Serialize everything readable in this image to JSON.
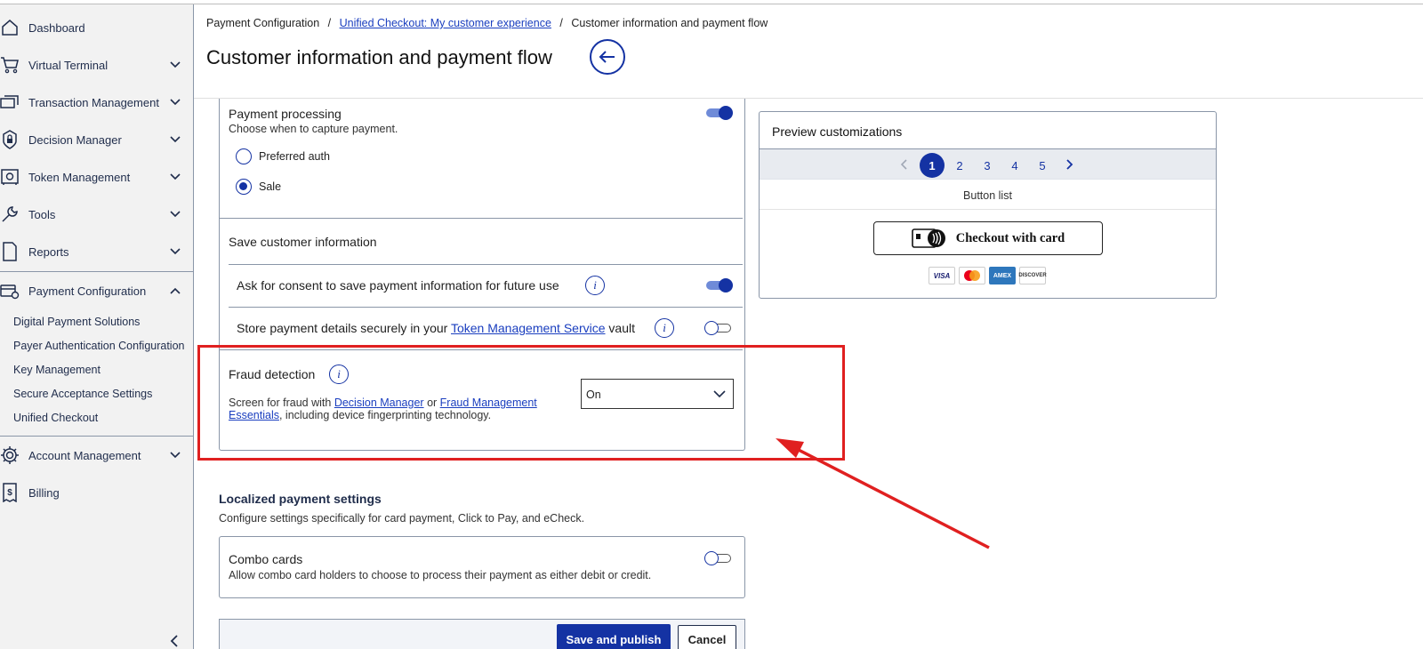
{
  "sidebar": {
    "items": [
      {
        "label": "Dashboard",
        "icon": "home-icon"
      },
      {
        "label": "Virtual Terminal",
        "icon": "cart-icon"
      },
      {
        "label": "Transaction Management",
        "icon": "transactions-icon"
      },
      {
        "label": "Decision Manager",
        "icon": "lock-shield-icon"
      },
      {
        "label": "Token Management",
        "icon": "safe-icon"
      },
      {
        "label": "Tools",
        "icon": "wrench-icon"
      },
      {
        "label": "Reports",
        "icon": "document-icon"
      },
      {
        "label": "Payment Configuration",
        "icon": "card-gear-icon"
      },
      {
        "label": "Account Management",
        "icon": "gear-icon"
      },
      {
        "label": "Billing",
        "icon": "receipt-icon"
      }
    ],
    "sub_items": [
      "Digital Payment Solutions",
      "Payer Authentication Configuration",
      "Key Management",
      "Secure Acceptance Settings",
      "Unified Checkout"
    ]
  },
  "header": {
    "breadcrumb": {
      "item1": "Payment Configuration",
      "separator": "/",
      "item2": "Unified Checkout: My customer experience",
      "item3": "Customer information and payment flow"
    },
    "title": "Customer information and payment flow"
  },
  "payment_processing": {
    "title": "Payment processing",
    "subtitle": "Choose when to capture payment.",
    "toggle_on": true,
    "options": [
      "Preferred auth",
      "Sale"
    ],
    "selected": "Sale"
  },
  "save_info": {
    "title": "Save customer information",
    "consent_label": "Ask for consent to save payment information for future use",
    "consent_on": true,
    "store_prefix": "Store payment details securely in your",
    "store_link": "Token Management Service",
    "store_suffix": "vault",
    "store_on": false
  },
  "fraud": {
    "title": "Fraud detection",
    "desc_prefix": "Screen for fraud with",
    "link1": "Decision Manager",
    "desc_mid": "or",
    "link2": "Fraud Management Essentials",
    "desc_suffix": ", including device fingerprinting technology.",
    "select_value": "On"
  },
  "localized": {
    "title": "Localized payment settings",
    "desc": "Configure settings specifically for card payment, Click to Pay, and eCheck.",
    "combo_title": "Combo cards",
    "combo_desc": "Allow combo card holders to choose to process their payment as either debit or credit.",
    "combo_on": false
  },
  "footer": {
    "save_label": "Save and publish",
    "cancel_label": "Cancel"
  },
  "preview": {
    "title": "Preview customizations",
    "pages": [
      "1",
      "2",
      "3",
      "4",
      "5"
    ],
    "active_page": "1",
    "section_label": "Button list",
    "checkout_label": "Checkout with card",
    "card_brands": [
      "VISA",
      "Mastercard",
      "AMEX",
      "DISCOVER"
    ]
  },
  "colors": {
    "brand": "#1432a3",
    "annotation": "#e02020"
  }
}
